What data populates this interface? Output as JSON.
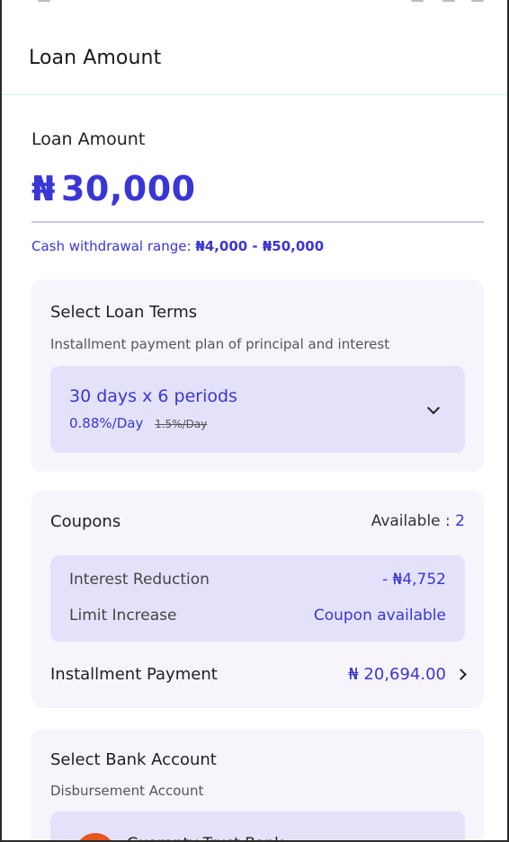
{
  "header": {
    "title": "Loan Amount"
  },
  "loan": {
    "label": "Loan Amount",
    "currency_symbol": "₦",
    "amount": "30,000",
    "range_prefix": "Cash withdrawal range:",
    "range_value": "₦4,000 - ₦50,000"
  },
  "terms": {
    "title": "Select Loan Terms",
    "subtitle": "Installment payment plan of principal and interest",
    "selected": "30 days x 6 periods",
    "rate": "0.88%/Day",
    "old_rate": "1.5%/Day"
  },
  "coupons": {
    "title": "Coupons",
    "available_label": "Available : ",
    "available_count": "2",
    "rows": [
      {
        "label": "Interest Reduction",
        "value": "- ₦4,752"
      },
      {
        "label": "Limit Increase",
        "value": "Coupon available"
      }
    ]
  },
  "installment": {
    "label": "Installment Payment",
    "value": "₦ 20,694.00"
  },
  "bank": {
    "title": "Select Bank Account",
    "subtitle": "Disbursement Account",
    "name": "Guaranty Trust Bank"
  },
  "colors": {
    "accent": "#3a36d6",
    "card_bg": "#f8f4fc",
    "box_bg": "#e4e2fb"
  }
}
